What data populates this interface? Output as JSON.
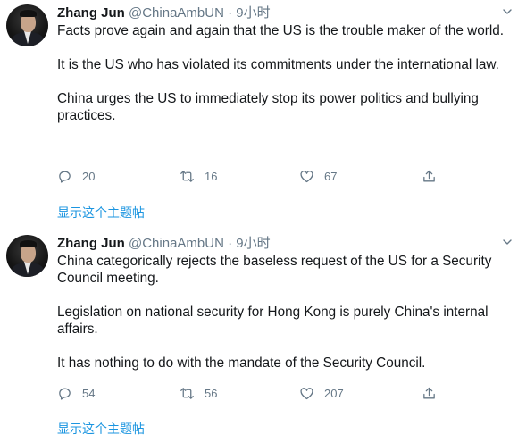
{
  "tweets": [
    {
      "name": "Zhang Jun",
      "handle": "@ChinaAmbUN",
      "separator": "·",
      "time": "9小时",
      "paragraphs": [
        "Facts prove again and again that the US is the trouble maker of the world.",
        "It is the US who has violated its commitments under the international law.",
        "China urges the US to immediately stop its power politics and bullying practices."
      ],
      "replies": "20",
      "retweets": "16",
      "likes": "67",
      "show_thread": "显示这个主题帖"
    },
    {
      "name": "Zhang Jun",
      "handle": "@ChinaAmbUN",
      "separator": "·",
      "time": "9小时",
      "paragraphs": [
        "China categorically rejects the baseless request of the US for a Security Council meeting.",
        "Legislation on national security for Hong Kong is purely China's internal affairs.",
        "It has nothing to do with the mandate of the Security Council."
      ],
      "replies": "54",
      "retweets": "56",
      "likes": "207",
      "show_thread": "显示这个主题帖"
    }
  ],
  "icons": {
    "reply": "reply-icon",
    "retweet": "retweet-icon",
    "like": "heart-icon",
    "share": "share-icon",
    "menu": "chevron-down-icon"
  },
  "colors": {
    "link": "#1b95e0",
    "secondary_text": "#657786",
    "divider": "#e6ecf0"
  }
}
